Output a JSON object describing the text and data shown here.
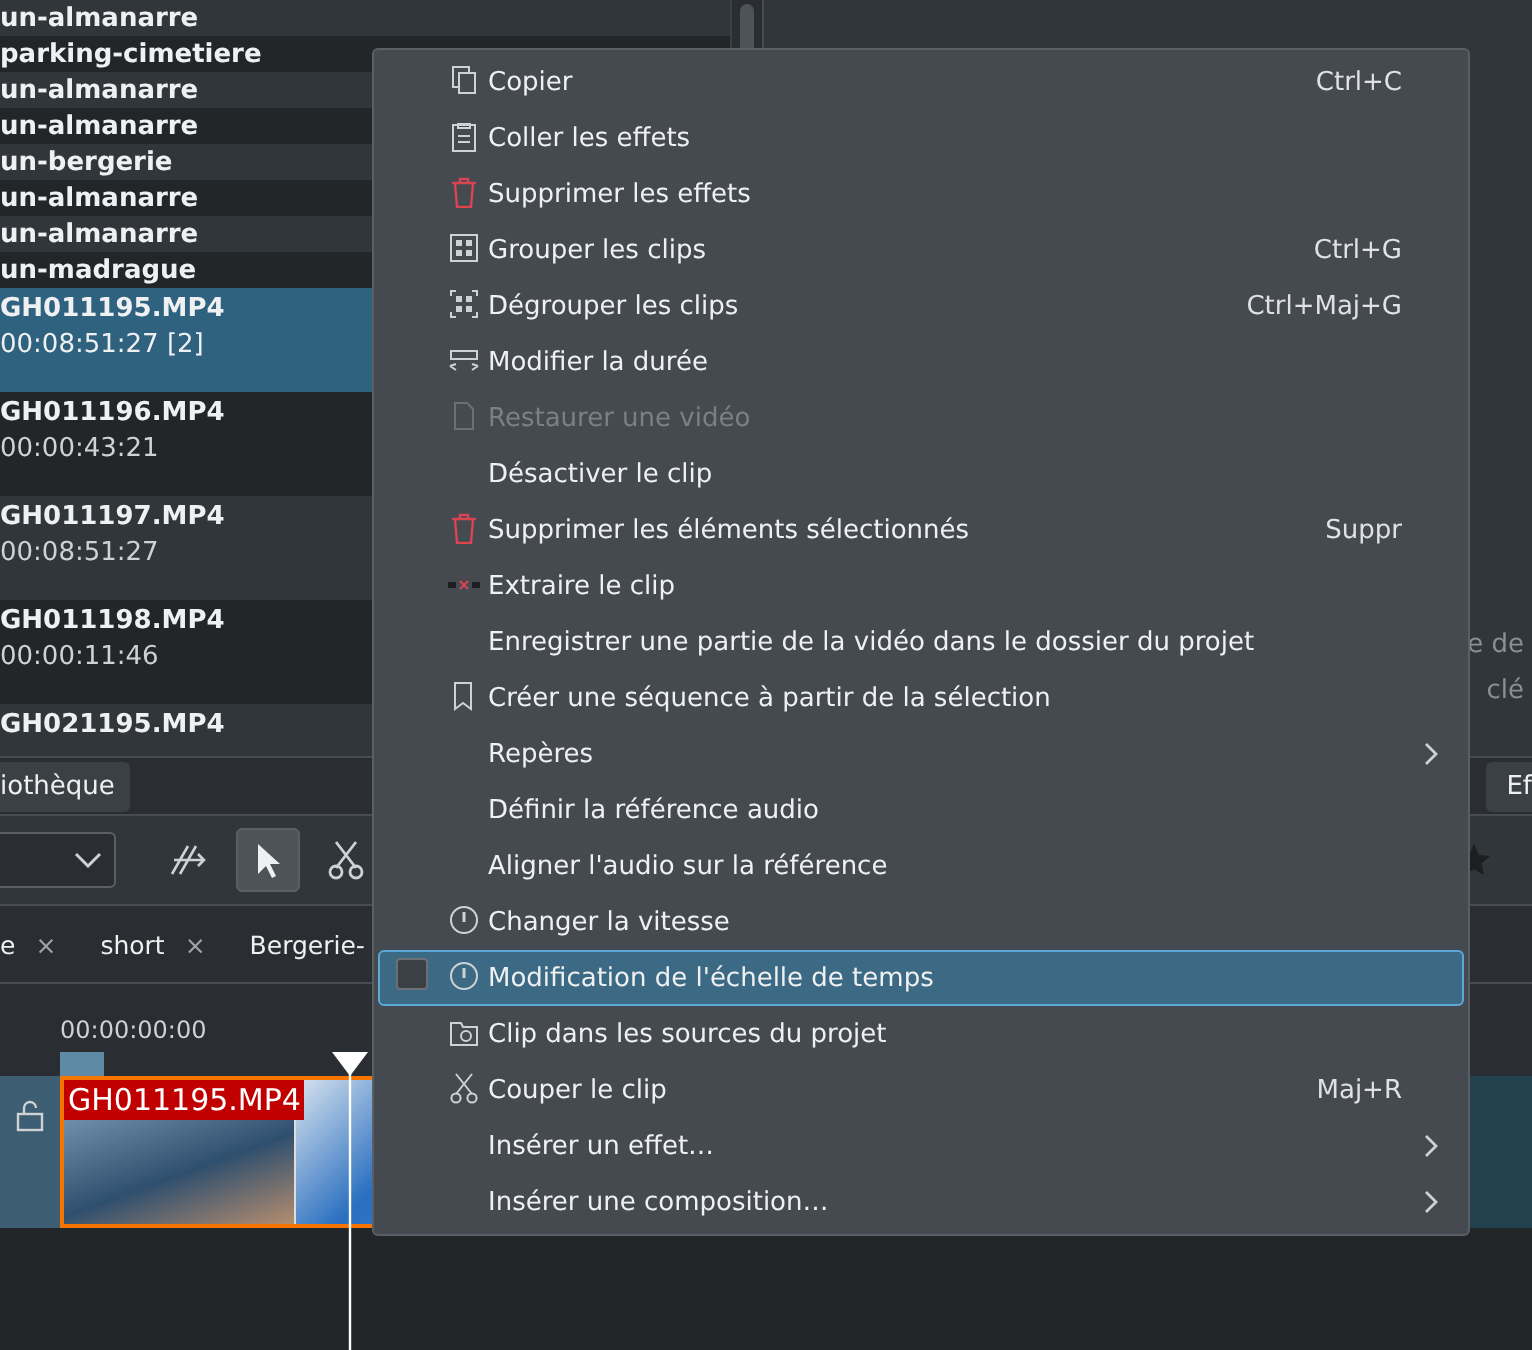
{
  "bin": {
    "rows": [
      {
        "kind": "folder",
        "title": "un-almanarre",
        "selected": false
      },
      {
        "kind": "folder",
        "title": "parking-cimetiere",
        "selected": false
      },
      {
        "kind": "folder",
        "title": "un-almanarre",
        "selected": false
      },
      {
        "kind": "folder",
        "title": "un-almanarre",
        "selected": false
      },
      {
        "kind": "folder",
        "title": "un-bergerie",
        "selected": false
      },
      {
        "kind": "folder",
        "title": "un-almanarre",
        "selected": false
      },
      {
        "kind": "folder",
        "title": "un-almanarre",
        "selected": false
      },
      {
        "kind": "folder",
        "title": "un-madrague",
        "selected": false
      },
      {
        "kind": "clip",
        "title": "GH011195.MP4",
        "duration": "00:08:51:27 [2]",
        "selected": true
      },
      {
        "kind": "clip",
        "title": "GH011196.MP4",
        "duration": "00:00:43:21",
        "selected": false
      },
      {
        "kind": "clip",
        "title": "GH011197.MP4",
        "duration": "00:08:51:27",
        "selected": false
      },
      {
        "kind": "clip",
        "title": "GH011198.MP4",
        "duration": "00:00:11:46",
        "selected": false
      },
      {
        "kind": "clip",
        "title": "GH021195.MP4",
        "selected": false
      }
    ]
  },
  "properties": {
    "texts": [
      "e de",
      "clé"
    ]
  },
  "dock_tabs": {
    "left": "iothèque",
    "right": "Ef"
  },
  "timeline_tabs": [
    {
      "label": "e",
      "close": "×"
    },
    {
      "label": "short",
      "close": "×"
    },
    {
      "label": "Bergerie-"
    }
  ],
  "ruler": {
    "start": "00:00:00:00"
  },
  "clip": {
    "label": "GH011195.MP4"
  },
  "menu": {
    "items": [
      {
        "label": "Copier",
        "shortcut": "Ctrl+C",
        "disabled": false,
        "selected": false,
        "submenu": false
      },
      {
        "label": "Coller les effets",
        "disabled": false,
        "selected": false,
        "submenu": false
      },
      {
        "label": "Supprimer les effets",
        "disabled": false,
        "selected": false,
        "submenu": false
      },
      {
        "label": "Grouper les clips",
        "shortcut": "Ctrl+G",
        "disabled": false,
        "selected": false,
        "submenu": false
      },
      {
        "label": "Dégrouper les clips",
        "shortcut": "Ctrl+Maj+G",
        "disabled": false,
        "selected": false,
        "submenu": false
      },
      {
        "label": "Modifier la durée",
        "disabled": false,
        "selected": false,
        "submenu": false
      },
      {
        "label": "Restaurer une vidéo",
        "disabled": true,
        "selected": false,
        "submenu": false
      },
      {
        "label": "Désactiver le clip",
        "disabled": false,
        "selected": false,
        "submenu": false
      },
      {
        "label": "Supprimer les éléments sélectionnés",
        "shortcut": "Suppr",
        "disabled": false,
        "selected": false,
        "submenu": false
      },
      {
        "label": "Extraire le clip",
        "disabled": false,
        "selected": false,
        "submenu": false
      },
      {
        "label": "Enregistrer une partie de la vidéo dans le dossier du projet",
        "disabled": false,
        "selected": false,
        "submenu": false
      },
      {
        "label": "Créer une séquence à partir de la sélection",
        "disabled": false,
        "selected": false,
        "submenu": false
      },
      {
        "label": "Repères",
        "disabled": false,
        "selected": false,
        "submenu": true
      },
      {
        "label": "Définir la référence audio",
        "disabled": false,
        "selected": false,
        "submenu": false
      },
      {
        "label": "Aligner l'audio sur la référence",
        "disabled": false,
        "selected": false,
        "submenu": false
      },
      {
        "label": "Changer la vitesse",
        "disabled": false,
        "selected": false,
        "submenu": false
      },
      {
        "label": "Modification de l'échelle de temps",
        "kind": "checkbox",
        "checked": false,
        "disabled": false,
        "selected": true,
        "submenu": false
      },
      {
        "label": "Clip dans les sources du projet",
        "disabled": false,
        "selected": false,
        "submenu": false
      },
      {
        "label": "Couper le clip",
        "shortcut": "Maj+R",
        "disabled": false,
        "selected": false,
        "submenu": false
      },
      {
        "label": "Insérer un effet…",
        "disabled": false,
        "selected": false,
        "submenu": true
      },
      {
        "label": "Insérer une composition…",
        "disabled": false,
        "selected": false,
        "submenu": true
      }
    ]
  }
}
